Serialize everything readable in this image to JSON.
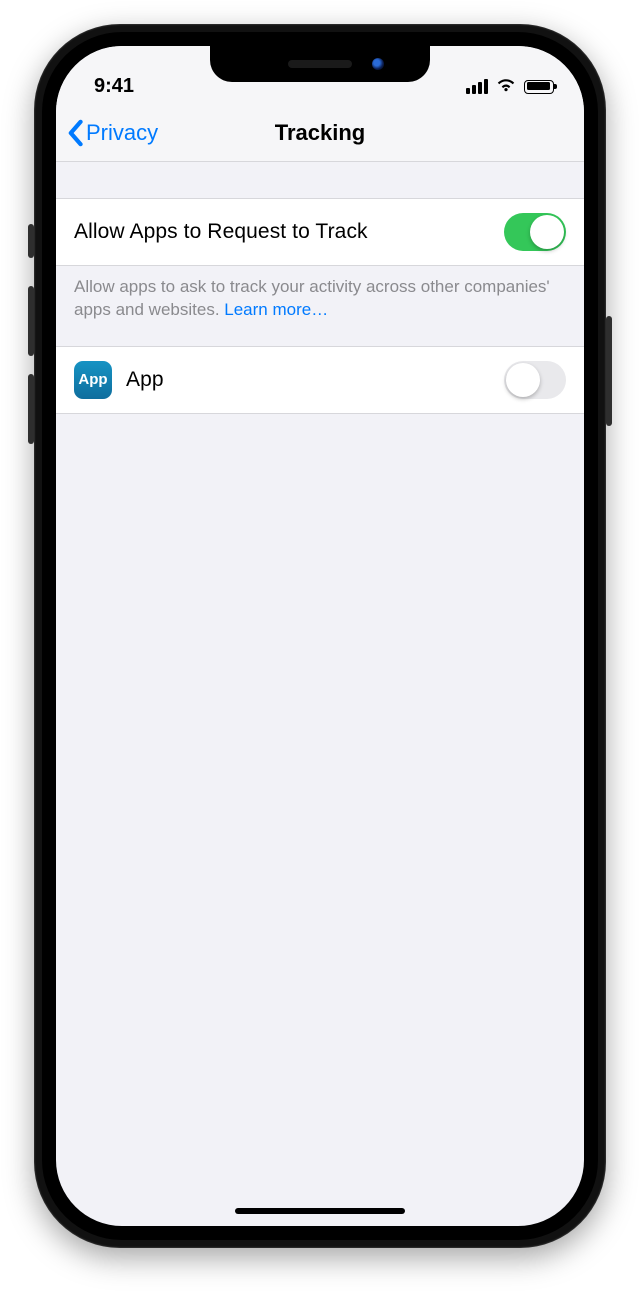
{
  "status": {
    "time": "9:41"
  },
  "nav": {
    "back_label": "Privacy",
    "title": "Tracking"
  },
  "tracking": {
    "allow_label": "Allow Apps to Request to Track",
    "allow_on": true,
    "footer_text": "Allow apps to ask to track your activity across other companies' apps and websites. ",
    "learn_more": "Learn more…"
  },
  "apps": [
    {
      "icon_text": "App",
      "name": "App",
      "on": false
    }
  ]
}
